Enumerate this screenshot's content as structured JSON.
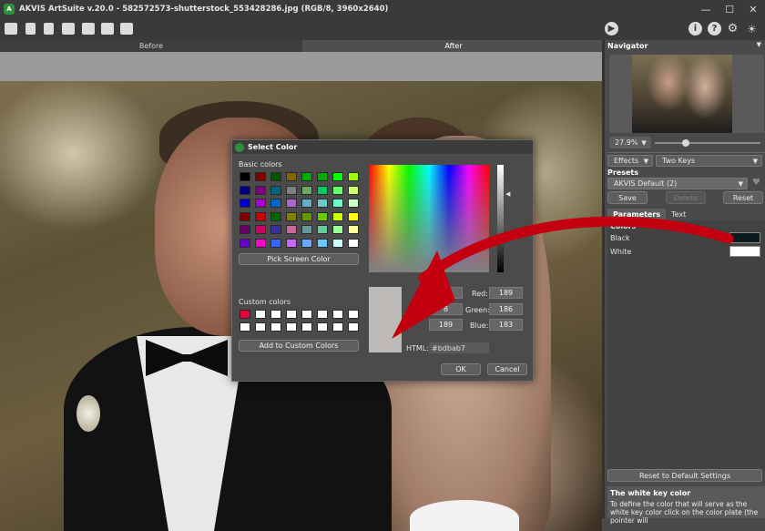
{
  "window": {
    "title": "AKVIS ArtSuite v.20.0 - 582572573-shutterstock_553428286.jpg (RGB/8, 3960x2640)",
    "minimize": "—",
    "maximize": "☐",
    "close": "✕"
  },
  "toolbar": {
    "run_icon": "run-icon",
    "info_icon": "info-icon",
    "help_icon": "help-icon",
    "settings_icon": "gear-icon",
    "tips_icon": "lightbulb-icon"
  },
  "view_tabs": {
    "before": "Before",
    "after": "After"
  },
  "navigator": {
    "title": "Navigator",
    "zoom": "27.9%",
    "zoom_fraction": 0.28
  },
  "right_panel": {
    "effects_label": "Effects",
    "effect_value": "Two Keys",
    "presets_title": "Presets",
    "preset_value": "AKVIS Default (2)",
    "save": "Save",
    "delete": "Delete",
    "reset": "Reset",
    "tab_parameters": "Parameters",
    "tab_text": "Text",
    "colors_header": "Colors",
    "black_label": "Black",
    "white_label": "White",
    "black_color": "#0b1a1f",
    "white_color": "#ffffff",
    "reset_defaults": "Reset to Default Settings",
    "hint_title": "The white key color",
    "hint_text": "To define the color that will serve as the white key color click on the color plate (the pointer will"
  },
  "dialog": {
    "title": "Select Color",
    "basic_colors_label": "Basic colors",
    "basic_colors": [
      "#000000",
      "#800000",
      "#005500",
      "#806600",
      "#00aa00",
      "#00aa00",
      "#00ff00",
      "#99ff00",
      "#000080",
      "#800080",
      "#006680",
      "#808080",
      "#66aa66",
      "#00cc66",
      "#66ff66",
      "#ccff66",
      "#0000cc",
      "#aa00cc",
      "#0066cc",
      "#aa66cc",
      "#66aacc",
      "#66cccc",
      "#66ffcc",
      "#ccffcc",
      "#800000",
      "#cc0000",
      "#006600",
      "#808000",
      "#669900",
      "#66cc00",
      "#ccff00",
      "#ffff00",
      "#660066",
      "#cc0066",
      "#333399",
      "#cc6699",
      "#669999",
      "#66cc99",
      "#99ff99",
      "#ffff99",
      "#6600cc",
      "#ff00cc",
      "#3366ff",
      "#cc66ff",
      "#66aaff",
      "#66ccff",
      "#ccffff",
      "#ffffff"
    ],
    "pick_screen": "Pick Screen Color",
    "custom_colors_label": "Custom colors",
    "custom_colors": [
      "#e8003c",
      "#ffffff",
      "#ffffff",
      "#ffffff",
      "#ffffff",
      "#ffffff",
      "#ffffff",
      "#ffffff",
      "#ffffff",
      "#ffffff",
      "#ffffff",
      "#ffffff",
      "#ffffff",
      "#ffffff",
      "#ffffff",
      "#ffffff"
    ],
    "add_custom": "Add to Custom Colors",
    "hue_value": "",
    "sat_value": "8",
    "val_value": "189",
    "red_label": "Red:",
    "red_value": "189",
    "green_label": "Green:",
    "green_value": "186",
    "blue_label": "Blue:",
    "blue_value": "183",
    "html_label": "HTML:",
    "html_value": "#bdbab7",
    "preview_color": "#bdbab7",
    "ok": "OK",
    "cancel": "Cancel"
  },
  "annotation": {
    "arrow_color": "#c40010"
  }
}
